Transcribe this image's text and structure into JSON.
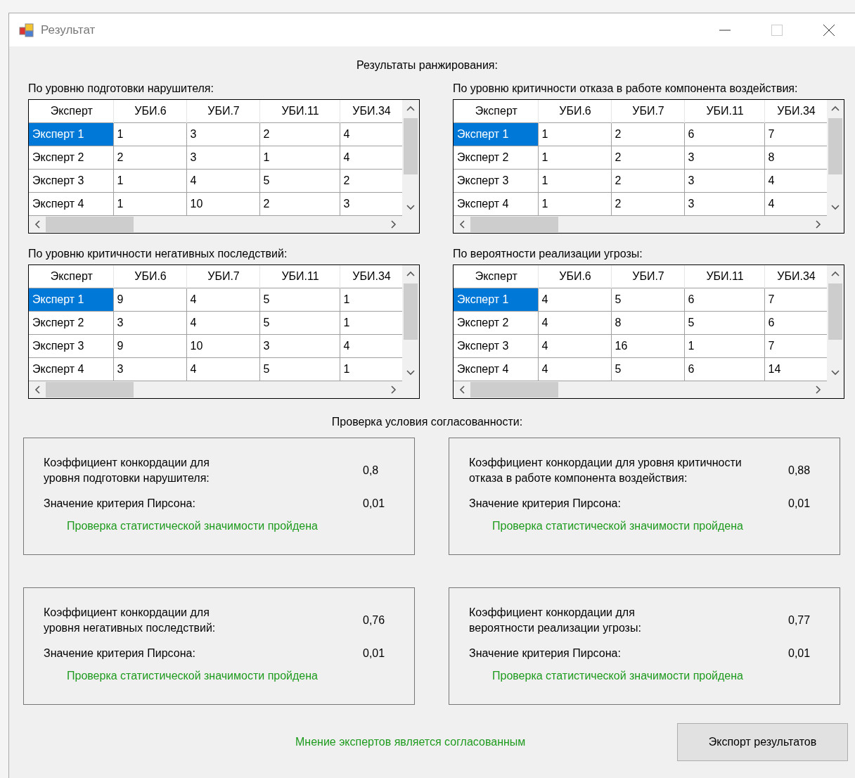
{
  "window": {
    "title": "Результат"
  },
  "ranking_title": "Результаты ранжирования:",
  "grids": [
    {
      "label": "По уровню подготовки нарушителя:",
      "columns": [
        "Эксперт",
        "УБИ.6",
        "УБИ.7",
        "УБИ.11",
        "УБИ.34"
      ],
      "rows": [
        {
          "expert": "Эксперт 1",
          "selected": true,
          "values": [
            "1",
            "3",
            "2",
            "4"
          ]
        },
        {
          "expert": "Эксперт 2",
          "selected": false,
          "values": [
            "2",
            "3",
            "1",
            "4"
          ]
        },
        {
          "expert": "Эксперт 3",
          "selected": false,
          "values": [
            "1",
            "4",
            "5",
            "2"
          ]
        },
        {
          "expert": "Эксперт 4",
          "selected": false,
          "values": [
            "1",
            "10",
            "2",
            "3"
          ]
        }
      ]
    },
    {
      "label": "По уровню критичности отказа в работе компонента воздействия:",
      "columns": [
        "Эксперт",
        "УБИ.6",
        "УБИ.7",
        "УБИ.11",
        "УБИ.34"
      ],
      "rows": [
        {
          "expert": "Эксперт 1",
          "selected": true,
          "values": [
            "1",
            "2",
            "6",
            "7"
          ]
        },
        {
          "expert": "Эксперт 2",
          "selected": false,
          "values": [
            "1",
            "2",
            "3",
            "8"
          ]
        },
        {
          "expert": "Эксперт 3",
          "selected": false,
          "values": [
            "1",
            "2",
            "3",
            "4"
          ]
        },
        {
          "expert": "Эксперт 4",
          "selected": false,
          "values": [
            "1",
            "2",
            "3",
            "4"
          ]
        }
      ]
    },
    {
      "label": "По уровню критичности негативных последствий:",
      "columns": [
        "Эксперт",
        "УБИ.6",
        "УБИ.7",
        "УБИ.11",
        "УБИ.34"
      ],
      "rows": [
        {
          "expert": "Эксперт 1",
          "selected": true,
          "values": [
            "9",
            "4",
            "5",
            "1"
          ]
        },
        {
          "expert": "Эксперт 2",
          "selected": false,
          "values": [
            "3",
            "4",
            "5",
            "1"
          ]
        },
        {
          "expert": "Эксперт 3",
          "selected": false,
          "values": [
            "9",
            "10",
            "3",
            "4"
          ]
        },
        {
          "expert": "Эксперт 4",
          "selected": false,
          "values": [
            "3",
            "4",
            "5",
            "1"
          ]
        }
      ]
    },
    {
      "label": "По вероятности реализации угрозы:",
      "columns": [
        "Эксперт",
        "УБИ.6",
        "УБИ.7",
        "УБИ.11",
        "УБИ.34"
      ],
      "rows": [
        {
          "expert": "Эксперт 1",
          "selected": true,
          "values": [
            "4",
            "5",
            "6",
            "7"
          ]
        },
        {
          "expert": "Эксперт 2",
          "selected": false,
          "values": [
            "4",
            "8",
            "5",
            "6"
          ]
        },
        {
          "expert": "Эксперт 3",
          "selected": false,
          "values": [
            "4",
            "16",
            "1",
            "7"
          ]
        },
        {
          "expert": "Эксперт 4",
          "selected": false,
          "values": [
            "4",
            "5",
            "6",
            "14"
          ]
        }
      ]
    }
  ],
  "consistency_title": "Проверка условия согласованности:",
  "checks": [
    {
      "coefficient_label": [
        "Коэффициент конкордации для",
        "уровня подготовки нарушителя:"
      ],
      "coefficient": "0,8",
      "pearson_label": "Значение критерия Пирсона:",
      "pearson_value": "0,01",
      "result": "Проверка статистической значимости пройдена"
    },
    {
      "coefficient_label": [
        "Коэффициент конкордации для уровня критичности",
        "отказа в работе компонента воздействия:"
      ],
      "coefficient": "0,88",
      "pearson_label": "Значение критерия Пирсона:",
      "pearson_value": "0,01",
      "result": "Проверка статистической значимости пройдена"
    },
    {
      "coefficient_label": [
        "Коэффициент конкордации для",
        "уровня негативных последствий:"
      ],
      "coefficient": "0,76",
      "pearson_label": "Значение критерия Пирсона:",
      "pearson_value": "0,01",
      "result": "Проверка статистической значимости пройдена"
    },
    {
      "coefficient_label": [
        "Коэффициент конкордации для",
        "вероятности реализации угрозы:"
      ],
      "coefficient": "0,77",
      "pearson_label": "Значение критерия Пирсона:",
      "pearson_value": "0,01",
      "result": "Проверка статистической значимости пройдена"
    }
  ],
  "conclusion": "Мнение экспертов является согласованным",
  "export_button": "Экспорт результатов"
}
